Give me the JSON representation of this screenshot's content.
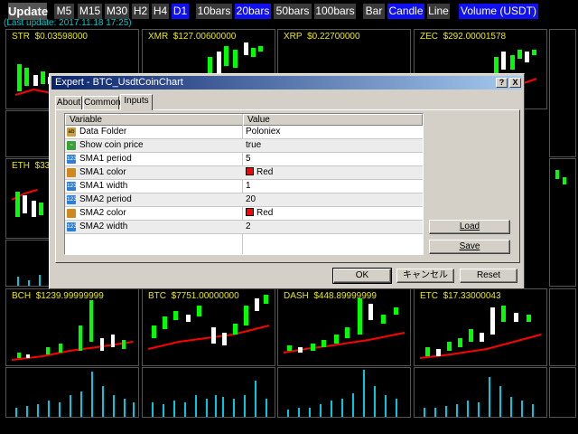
{
  "toolbar": {
    "update": "Update",
    "timeframes": [
      "M5",
      "M15",
      "M30",
      "H2",
      "H4",
      "D1"
    ],
    "bars": [
      "10bars",
      "20bars",
      "50bars",
      "100bars"
    ],
    "types": [
      "Bar",
      "Candle",
      "Line"
    ],
    "volume": "Volume (USDT)",
    "last_update": "(Last update: 2017.11.18 17:25)",
    "colors": {
      "active": "#1010f0",
      "inactive": "#3a3a3a"
    }
  },
  "charts": [
    {
      "symbol": "STR",
      "price": "$0.03598000"
    },
    {
      "symbol": "XMR",
      "price": "$127.00600000"
    },
    {
      "symbol": "XRP",
      "price": "$0.22700000"
    },
    {
      "symbol": "ZEC",
      "price": "$292.00001578"
    },
    {
      "symbol": "ETH",
      "price": "$33"
    },
    {
      "symbol": "BCH",
      "price": "$1239.99999999"
    },
    {
      "symbol": "BTC",
      "price": "$7751.00000000"
    },
    {
      "symbol": "DASH",
      "price": "$448.89999999"
    },
    {
      "symbol": "ETC",
      "price": "$17.33000043"
    }
  ],
  "chart_colors": {
    "bull": "#00ff00",
    "bear": "#ffffff",
    "sma": "#ff0000",
    "volume": "#00c8e0",
    "title": "#e8e800"
  },
  "dialog": {
    "title": "Expert - BTC_UsdtCoinChart",
    "help": "?",
    "close": "X",
    "tabs": [
      "About",
      "Common",
      "Inputs"
    ],
    "active_tab": "Inputs",
    "columns": [
      "Variable",
      "Value"
    ],
    "rows": [
      {
        "icon": "str",
        "variable": "Data Folder",
        "value": "Poloniex"
      },
      {
        "icon": "bool",
        "variable": "Show coin price",
        "value": "true"
      },
      {
        "icon": "num",
        "variable": "SMA1 period",
        "value": "5"
      },
      {
        "icon": "color",
        "variable": "SMA1 color",
        "value": "Red",
        "swatch": "#ff0000"
      },
      {
        "icon": "num",
        "variable": "SMA1 width",
        "value": "1"
      },
      {
        "icon": "num",
        "variable": "SMA2 period",
        "value": "20"
      },
      {
        "icon": "color",
        "variable": "SMA2 color",
        "value": "Red",
        "swatch": "#ff0000"
      },
      {
        "icon": "num",
        "variable": "SMA2 width",
        "value": "2"
      }
    ],
    "icon_text": {
      "num": "123",
      "str": "ab",
      "bool": "~",
      "color": ""
    },
    "load": "Load",
    "save": "Save",
    "ok": "OK",
    "cancel": "キャンセル",
    "reset": "Reset"
  }
}
